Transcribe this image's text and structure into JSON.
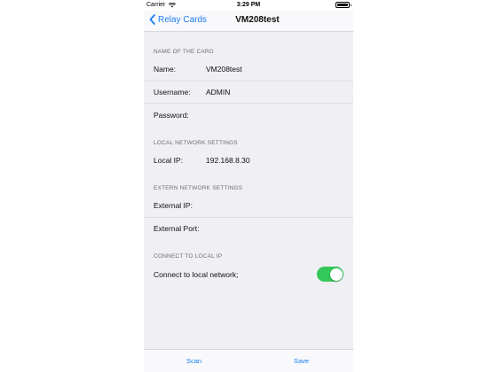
{
  "status_bar": {
    "carrier": "Carrier",
    "time": "3:29 PM"
  },
  "nav": {
    "back_label": "Relay Cards",
    "title": "VM208test"
  },
  "sections": {
    "card": {
      "header": "NAME OF THE CARD",
      "name_label": "Name:",
      "name_value": "VM208test",
      "username_label": "Username:",
      "username_value": "ADMIN",
      "password_label": "Password:"
    },
    "local": {
      "header": "LOCAL NETWORK SETTINGS",
      "ip_label": "Local IP:",
      "ip_value": "192.168.8.30"
    },
    "extern": {
      "header": "EXTERN NETWORK SETTINGS",
      "ip_label": "External IP:",
      "port_label": "External Port:"
    },
    "connect": {
      "header": "CONNECT TO LOCAL IP",
      "toggle_label": "Connect to local network;",
      "toggle_on": true
    }
  },
  "toolbar": {
    "scan_label": "Scan",
    "save_label": "Save"
  },
  "colors": {
    "accent": "#1a7cf5",
    "toggle_on": "#34c759",
    "grouped_bg": "#efeff4"
  }
}
